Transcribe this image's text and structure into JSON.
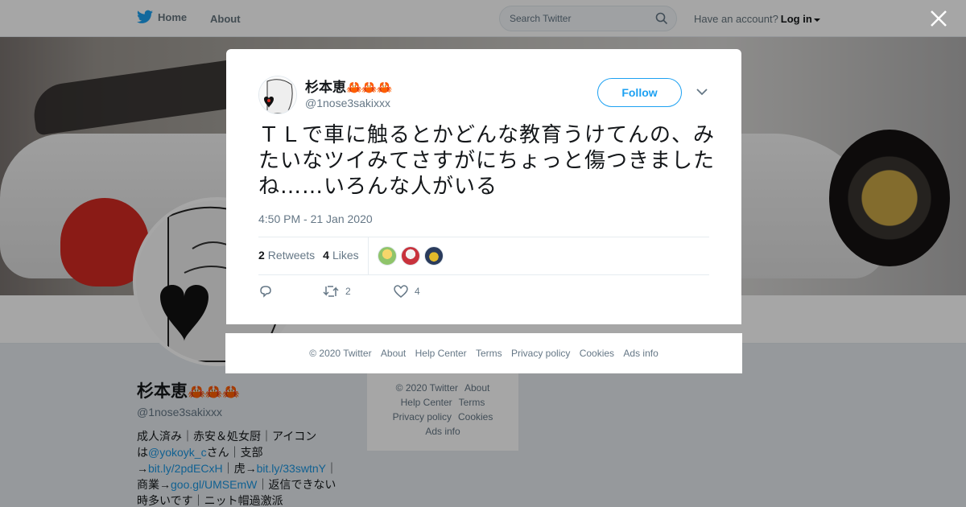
{
  "nav": {
    "home_label": "Home",
    "about_label": "About",
    "search_placeholder": "Search Twitter",
    "account_prompt": "Have an account?",
    "login_label": "Log in"
  },
  "profile": {
    "display_name": "杉本恵",
    "name_emoji": "🦀🦀🦀",
    "handle": "@1nose3sakixxx",
    "bio_lines": [
      "成人済み｜赤安＆処女厨｜アイコン",
      "は",
      "@yokoyk_c",
      "さん｜支部",
      "→",
      "bit.ly/2pdECxH",
      "｜虎→",
      "bit.ly/33swtnY",
      "｜",
      "商業→",
      "goo.gl/UMSEmW",
      "｜返信できない",
      "時多いです｜ニット帽過激派"
    ]
  },
  "side_footer": {
    "copyright": "© 2020 Twitter",
    "about": "About",
    "help": "Help Center",
    "terms": "Terms",
    "privacy": "Privacy policy",
    "cookies": "Cookies",
    "ads": "Ads info"
  },
  "tweet": {
    "author_name": "杉本恵",
    "author_emoji": "🦀🦀🦀",
    "author_handle": "@1nose3sakixxx",
    "follow_label": "Follow",
    "text": "ＴＬで車に触るとかどんな教育うけてんの、みたいなツイみてさすがにちょっと傷つきましたね……いろんな人がいる",
    "timestamp": "4:50 PM - 21 Jan 2020",
    "retweets_count": "2",
    "retweets_label": "Retweets",
    "likes_count": "4",
    "likes_label": "Likes",
    "action_retweet_count": "2",
    "action_like_count": "4",
    "liker_colors": [
      "#8fc46a",
      "#c8323c",
      "#e2b92a"
    ]
  },
  "modal_footer": {
    "copyright": "© 2020 Twitter",
    "about": "About",
    "help": "Help Center",
    "terms": "Terms",
    "privacy": "Privacy policy",
    "cookies": "Cookies",
    "ads": "Ads info"
  },
  "colors": {
    "accent": "#1da1f2",
    "link": "#1b95e0",
    "crab": "#cc1f2f"
  }
}
